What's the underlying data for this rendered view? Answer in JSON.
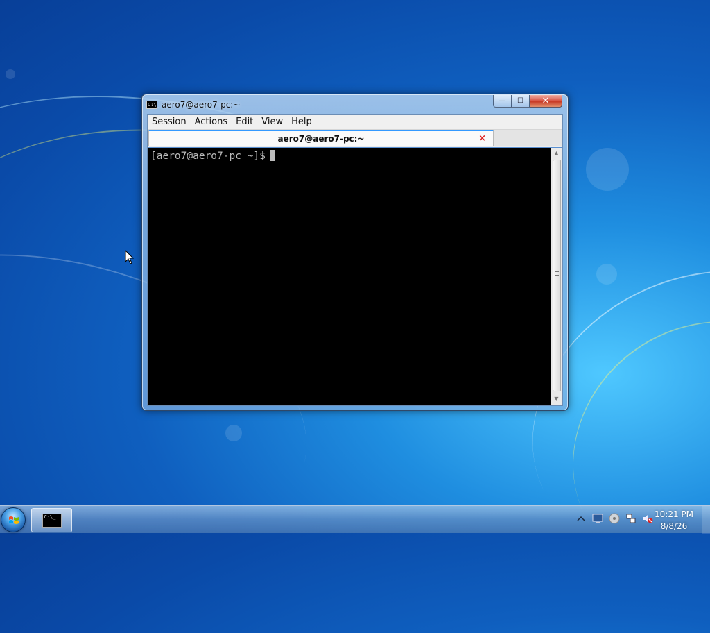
{
  "window": {
    "title": "aero7@aero7-pc:~",
    "app_icon_text": "C:\\_",
    "buttons": {
      "minimize": "—",
      "maximize": "☐",
      "close": "✕"
    }
  },
  "menubar": {
    "items": [
      "Session",
      "Actions",
      "Edit",
      "View",
      "Help"
    ]
  },
  "tabs": [
    {
      "label": "aero7@aero7-pc:~",
      "close": "×"
    }
  ],
  "terminal": {
    "prompt": "[aero7@aero7-pc ~]$"
  },
  "taskbar": {
    "task_icon_text": "C:\\_",
    "clock": {
      "time": "10:21 PM",
      "date": "8/8/26"
    },
    "tray_icons": [
      "chevron-up-icon",
      "monitor-icon",
      "disc-icon",
      "network-icon",
      "volume-muted-icon"
    ]
  }
}
